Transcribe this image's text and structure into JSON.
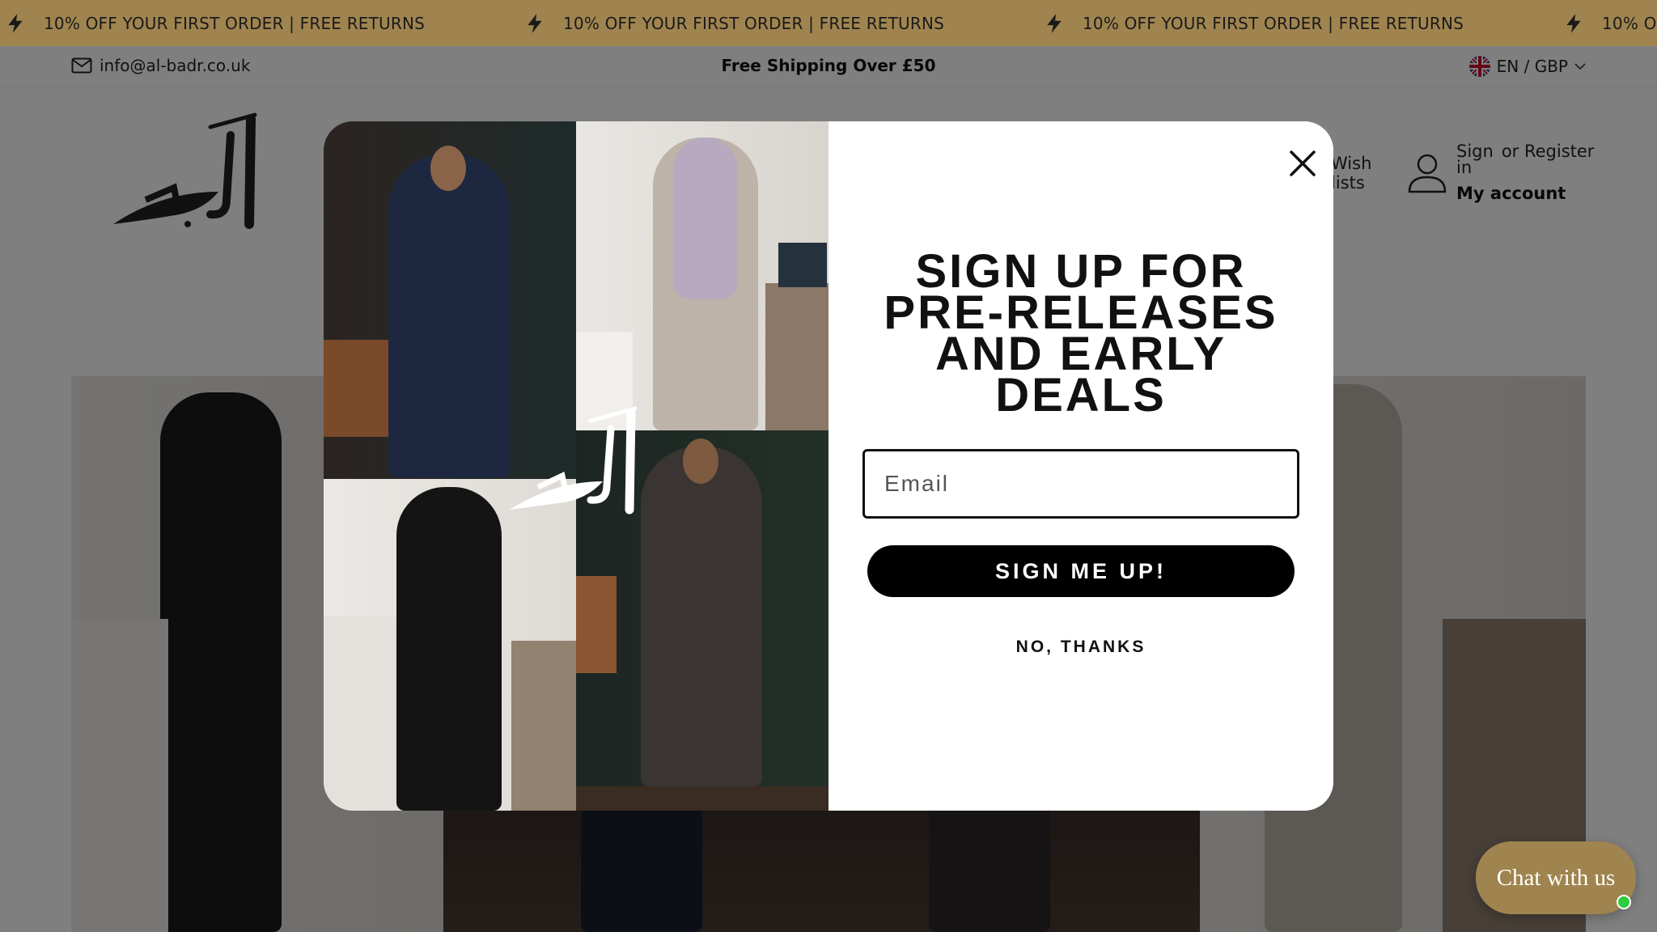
{
  "announcement": {
    "text": "10% OFF YOUR FIRST ORDER | FREE RETURNS",
    "repeat": 4
  },
  "topbar": {
    "email": "info@al-badr.co.uk",
    "shipping": "Free Shipping Over £50",
    "locale": "EN / GBP"
  },
  "header": {
    "wishlist_line1": "Wish",
    "wishlist_line2": "lists",
    "sign_in_1": "Sign",
    "sign_in_2": "in",
    "or_register": "or Register",
    "my_account": "My account"
  },
  "popup": {
    "headline_lines": [
      "SIGN UP FOR",
      "PRE-RELEASES",
      "AND EARLY",
      "DEALS"
    ],
    "email_placeholder": "Email",
    "submit_label": "SIGN ME UP!",
    "decline_label": "NO, THANKS"
  },
  "chat": {
    "label": "Chat with us"
  },
  "colors": {
    "brand": "#a0844f",
    "overlay": "rgba(0,0,0,0.5)",
    "online": "#2ecc40"
  }
}
